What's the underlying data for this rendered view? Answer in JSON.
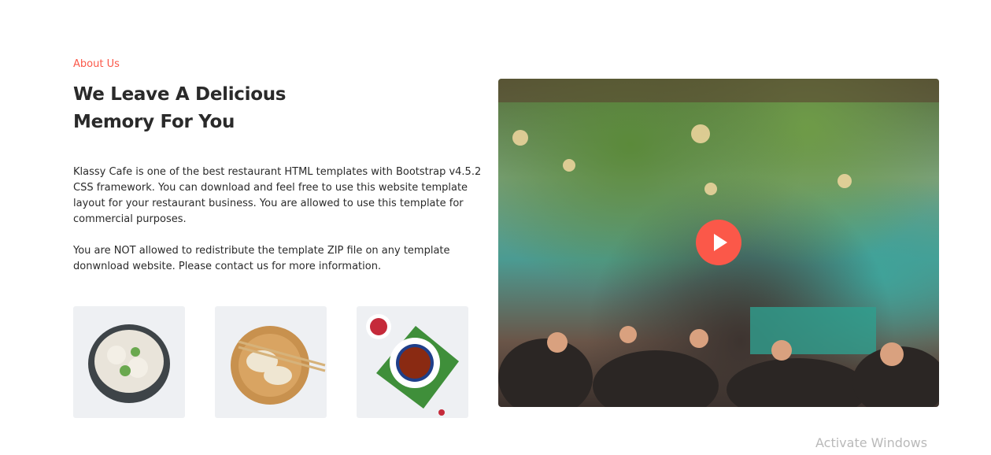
{
  "about": {
    "eyebrow": "About Us",
    "title_line1": "We Leave A Delicious",
    "title_line2": "Memory For You",
    "paragraph1": "Klassy Cafe is one of the best restaurant HTML templates with Bootstrap v4.5.2 CSS framework. You can download and feel free to use this website template layout for your restaurant business. You are allowed to use this template for commercial purposes.",
    "paragraph2": "You are NOT allowed to redistribute the template ZIP file on any template donwnload website. Please contact us for more information."
  },
  "video": {
    "play_icon": "play-icon",
    "accent": "#fb5849"
  },
  "watermark": "Activate Windows"
}
